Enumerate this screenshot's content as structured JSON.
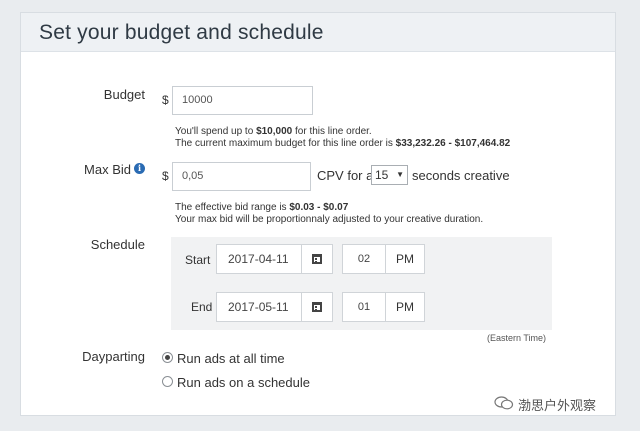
{
  "header": {
    "title": "Set your budget and schedule"
  },
  "budget": {
    "label": "Budget",
    "currency": "$",
    "value": "10000",
    "note_prefix1": "You'll spend up to ",
    "note_amount": "$10,000",
    "note_suffix1": " for this line order.",
    "note_prefix2": "The current maximum budget for this line order is ",
    "note_range": "$33,232.26 - $107,464.82"
  },
  "max_bid": {
    "label": "Max Bid",
    "info_icon": "info-icon",
    "currency": "$",
    "value": "0,05",
    "cpv_text": "CPV for a",
    "seconds_selected": "15",
    "seconds_text": "seconds creative",
    "note_prefix1": "The effective bid range is ",
    "note_range": "$0.03 - $0.07",
    "note_line2": "Your max bid will be proportionnaly adjusted to your creative duration."
  },
  "schedule": {
    "label": "Schedule",
    "start": {
      "label": "Start",
      "date": "2017-04-11",
      "hour": "02",
      "ampm": "PM"
    },
    "end": {
      "label": "End",
      "date": "2017-05-11",
      "hour": "01",
      "ampm": "PM"
    },
    "timezone": "(Eastern Time)"
  },
  "dayparting": {
    "label": "Dayparting",
    "options": [
      {
        "label": "Run ads at all time",
        "checked": true
      },
      {
        "label": "Run ads on a schedule",
        "checked": false
      }
    ]
  },
  "watermark": {
    "text": "渤思户外观察"
  }
}
